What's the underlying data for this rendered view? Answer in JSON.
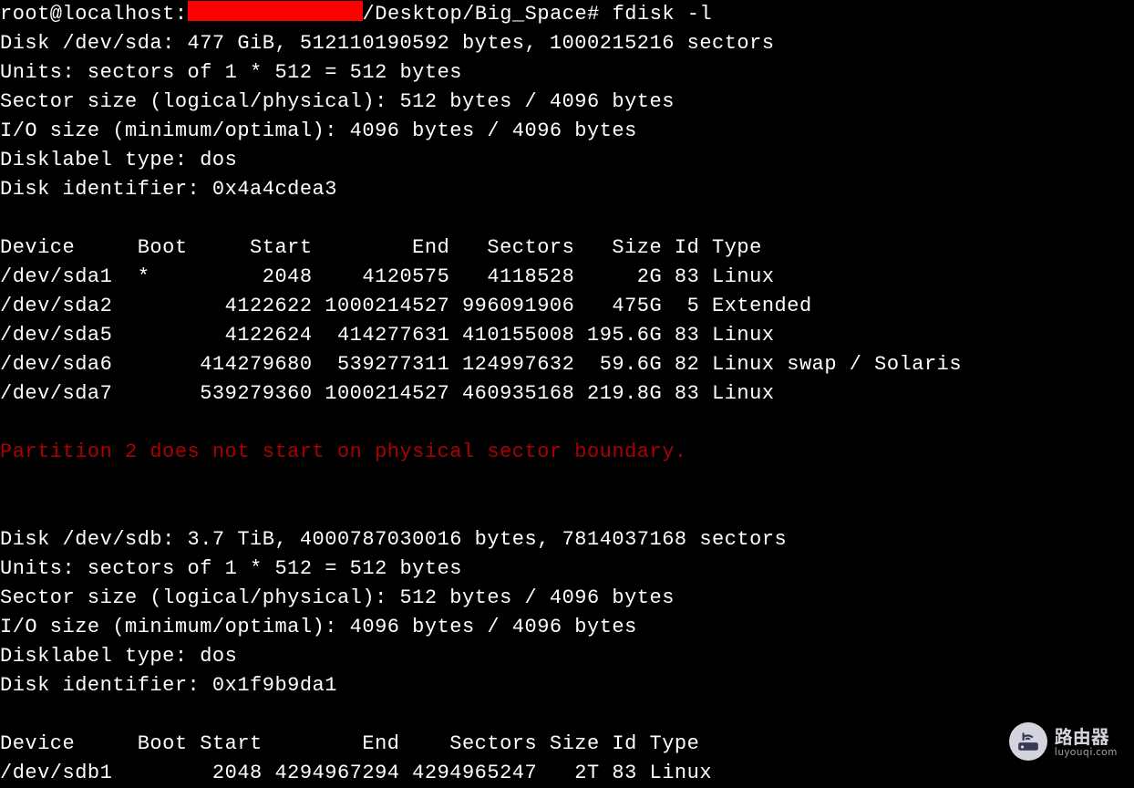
{
  "prompt": {
    "user_host": "root@localhost:",
    "redacted": true,
    "path_suffix": "/Desktop/Big_Space#",
    "command": "fdisk -l"
  },
  "disk_a": {
    "header": "Disk /dev/sda: 477 GiB, 512110190592 bytes, 1000215216 sectors",
    "units": "Units: sectors of 1 * 512 = 512 bytes",
    "sector_size": "Sector size (logical/physical): 512 bytes / 4096 bytes",
    "io_size": "I/O size (minimum/optimal): 4096 bytes / 4096 bytes",
    "label_type": "Disklabel type: dos",
    "identifier": "Disk identifier: 0x4a4cdea3"
  },
  "table_a": {
    "header": "Device     Boot     Start        End   Sectors   Size Id Type",
    "rows": [
      "/dev/sda1  *         2048    4120575   4118528     2G 83 Linux",
      "/dev/sda2         4122622 1000214527 996091906   475G  5 Extended",
      "/dev/sda5         4122624  414277631 410155008 195.6G 83 Linux",
      "/dev/sda6       414279680  539277311 124997632  59.6G 82 Linux swap / Solaris",
      "/dev/sda7       539279360 1000214527 460935168 219.8G 83 Linux"
    ]
  },
  "warning": "Partition 2 does not start on physical sector boundary.",
  "disk_b": {
    "header": "Disk /dev/sdb: 3.7 TiB, 4000787030016 bytes, 7814037168 sectors",
    "units": "Units: sectors of 1 * 512 = 512 bytes",
    "sector_size": "Sector size (logical/physical): 512 bytes / 4096 bytes",
    "io_size": "I/O size (minimum/optimal): 4096 bytes / 4096 bytes",
    "label_type": "Disklabel type: dos",
    "identifier": "Disk identifier: 0x1f9b9da1"
  },
  "table_b": {
    "header": "Device     Boot Start        End    Sectors Size Id Type",
    "rows": [
      "/dev/sdb1        2048 4294967294 4294965247   2T 83 Linux"
    ]
  },
  "watermark": {
    "title": "路由器",
    "sub": "luyouqi.com"
  }
}
